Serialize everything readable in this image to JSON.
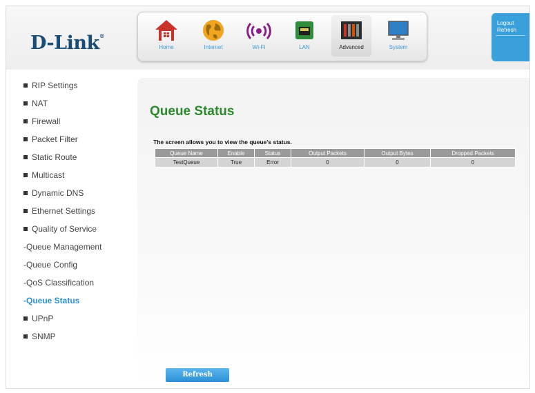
{
  "brand": {
    "logo_text": "D-Link",
    "logo_mark": "®"
  },
  "top_nav": [
    {
      "label": "Home",
      "icon": "home-icon"
    },
    {
      "label": "Internet",
      "icon": "globe-icon"
    },
    {
      "label": "Wi-Fi",
      "icon": "wifi-icon"
    },
    {
      "label": "LAN",
      "icon": "lan-icon"
    },
    {
      "label": "Advanced",
      "icon": "tools-icon",
      "active": true
    },
    {
      "label": "System",
      "icon": "monitor-icon"
    }
  ],
  "account": {
    "logout": "Logout",
    "refresh": "Refresh"
  },
  "sidebar": {
    "items": [
      "RIP Settings",
      "NAT",
      "Firewall",
      "Packet Filter",
      "Static Route",
      "Multicast",
      "Dynamic DNS",
      "Ethernet Settings",
      "Quality of Service"
    ],
    "sub_items": [
      "-Queue Management",
      "-Queue Config",
      "-QoS Classification",
      "-Queue Status"
    ],
    "items_after": [
      "UPnP",
      "SNMP"
    ],
    "active_sub": "-Queue Status"
  },
  "main": {
    "title": "Queue Status",
    "description": "The screen allows you to view the queue's status.",
    "table": {
      "headers": [
        "Queue Name",
        "Enable",
        "Status",
        "Output Packets",
        "Output Bytes",
        "Dropped Packets"
      ],
      "rows": [
        [
          "TestQueue",
          "True",
          "Error",
          "0",
          "0",
          "0"
        ]
      ]
    },
    "refresh_button": "Refresh"
  },
  "colors": {
    "accent": "#3aa0dc",
    "title_green": "#2b8a2b",
    "header_gray": "#9a9a9a"
  }
}
